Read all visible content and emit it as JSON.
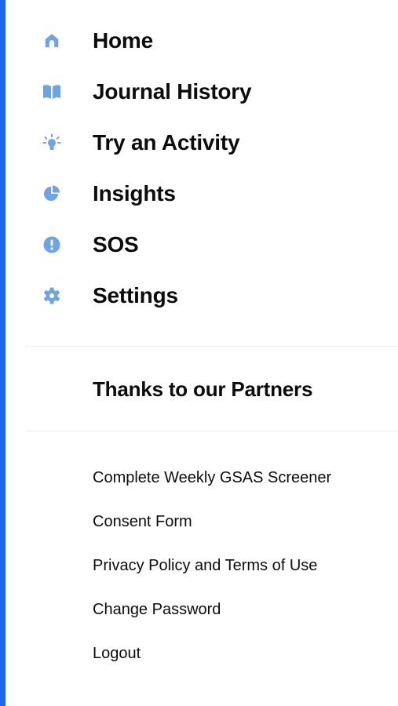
{
  "colors": {
    "accent": "#1e66f0",
    "icon": "#6fa3e6",
    "text": "#0c0c0c",
    "divider": "#eeeeee"
  },
  "nav": {
    "items": [
      {
        "label": "Home",
        "icon": "home-icon"
      },
      {
        "label": "Journal History",
        "icon": "book-icon"
      },
      {
        "label": "Try an Activity",
        "icon": "lightbulb-icon"
      },
      {
        "label": "Insights",
        "icon": "pie-chart-icon"
      },
      {
        "label": "SOS",
        "icon": "alert-icon"
      },
      {
        "label": "Settings",
        "icon": "gear-icon"
      }
    ]
  },
  "partners": {
    "label": "Thanks to our Partners"
  },
  "links": {
    "items": [
      {
        "label": "Complete Weekly GSAS Screener"
      },
      {
        "label": "Consent Form"
      },
      {
        "label": "Privacy Policy and Terms of Use"
      },
      {
        "label": "Change Password"
      },
      {
        "label": "Logout"
      }
    ]
  }
}
